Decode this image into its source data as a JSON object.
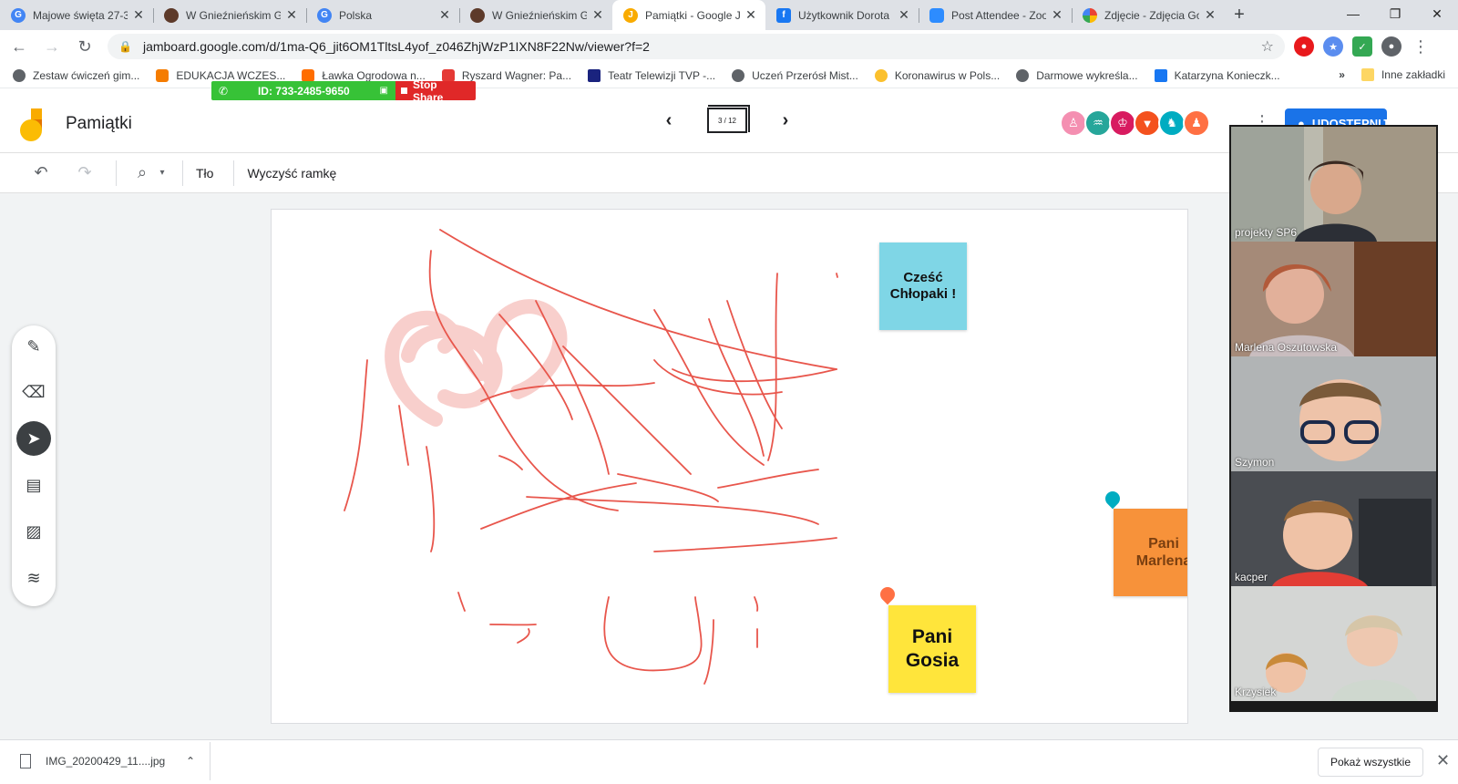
{
  "browser": {
    "tabs": [
      {
        "title": "Majowe święta 27-3",
        "fav_color": "#4285f4",
        "fav_glyph": "G"
      },
      {
        "title": "W Gnieźnieńskim Gr",
        "fav_color": "#5d3a2a",
        "fav_glyph": "●"
      },
      {
        "title": "Polska",
        "fav_color": "#4285f4",
        "fav_glyph": "G"
      },
      {
        "title": "W Gnieźnieńskim Gr",
        "fav_color": "#5d3a2a",
        "fav_glyph": "●"
      },
      {
        "title": "Pamiątki - Google Ja",
        "fav_color": "#f9ab00",
        "fav_glyph": "J"
      },
      {
        "title": "Użytkownik Dorota",
        "fav_color": "#1877f2",
        "fav_glyph": "f"
      },
      {
        "title": "Post Attendee - Zoo",
        "fav_color": "#2d8cff",
        "fav_glyph": "■"
      },
      {
        "title": "Zdjęcie - Zdjęcia Go",
        "fav_color": "#ea4335",
        "fav_glyph": "✿"
      }
    ],
    "url": "jamboard.google.com/d/1ma-Q6_jit6OM1TltsL4yof_z046ZhjWzP1IXN8F22Nw/viewer?f=2",
    "bookmarks": [
      {
        "label": "Zestaw ćwiczeń gim...",
        "color": "#5f6368"
      },
      {
        "label": "EDUKACJA WCZES...",
        "color": "#f57c00"
      },
      {
        "label": "Ławka Ogrodowa n...",
        "color": "#ff6d00"
      },
      {
        "label": "Ryszard Wagner: Pa...",
        "color": "#e53935"
      },
      {
        "label": "Teatr Telewizji TVP -...",
        "color": "#1a237e"
      },
      {
        "label": "Uczeń Przerósł Mist...",
        "color": "#5f6368"
      },
      {
        "label": "Koronawirus w Pols...",
        "color": "#fbc02d"
      },
      {
        "label": "Darmowe wykreśla...",
        "color": "#5f6368"
      },
      {
        "label": "Katarzyna Konieczk...",
        "color": "#1877f2"
      }
    ],
    "bookmarks_more": "»",
    "other_bookmarks": "Inne zakładki"
  },
  "zoom": {
    "meeting_id": "ID: 733-2485-9650",
    "stop_share": "Stop Share",
    "participants": [
      {
        "name": "projekty SP6",
        "bg": "#8a8f86"
      },
      {
        "name": "Marlena Oszutowska",
        "bg": "#8c6b5a"
      },
      {
        "name": "Szymon",
        "bg": "#a5a8ab"
      },
      {
        "name": "kacper",
        "bg": "#5a5e62"
      },
      {
        "name": "Krzysiek",
        "bg": "#c8cbcc"
      }
    ]
  },
  "jamboard": {
    "title": "Pamiątki",
    "frame_counter": "3 / 12",
    "share_label": "UDOSTĘPNIJ",
    "toolbar": {
      "background": "Tło",
      "clear_frame": "Wyczyść ramkę"
    },
    "stickies": [
      {
        "text": "Cześć Chłopaki !",
        "color": "#7fd6e6"
      },
      {
        "text": "Pani Gosia",
        "color": "#ffe53b"
      },
      {
        "text": "Pani Marlena",
        "color": "#f7923a"
      }
    ],
    "collaborator_colors": [
      "#f48fb1",
      "#26a69a",
      "#d81b60",
      "#f4511e",
      "#00acc1",
      "#ff7043"
    ]
  },
  "downloads": {
    "file": "IMG_20200429_11....jpg",
    "show_all": "Pokaż wszystkie"
  }
}
